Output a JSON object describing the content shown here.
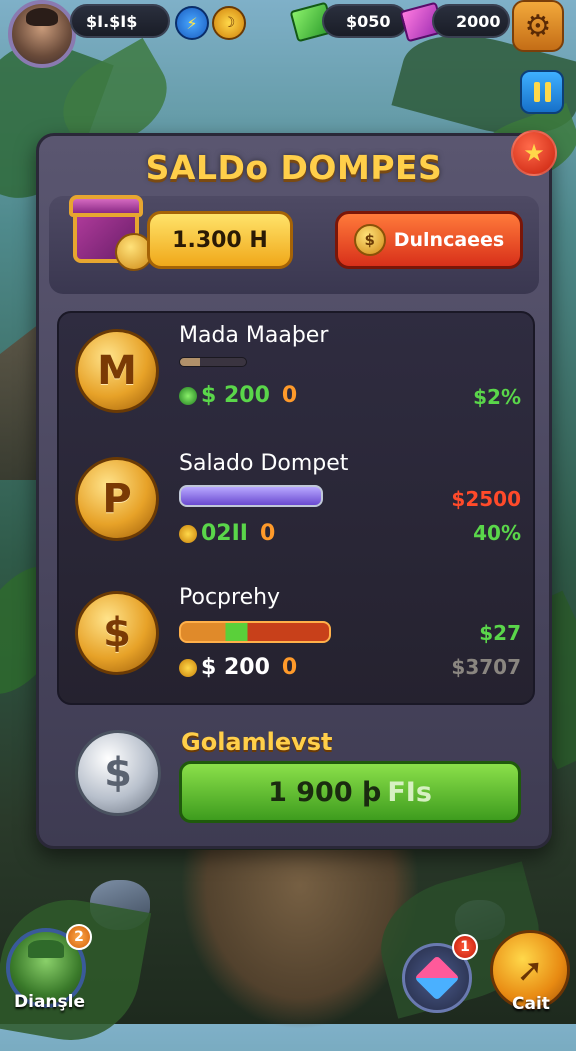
{
  "hud": {
    "currency_1": "$I.$I$",
    "icon_1": "lightning-icon",
    "icon_2": "coin-icon",
    "currency_2": "$050",
    "currency_3": "2000"
  },
  "panel": {
    "title": "SALDo DOMPES",
    "balance": "1.300 H",
    "action_button": "Dulncaees",
    "action_coin_symbol": "$"
  },
  "rows": [
    {
      "name": "Mada Maaþer",
      "coin_symbol": "M",
      "value": "$ 200",
      "value_suffix": "0",
      "right_1": "",
      "right_2": "$2%",
      "right_1_color": "#ff4a2a",
      "right_2_color": "#5ad64a"
    },
    {
      "name": "Salado Dompet",
      "coin_symbol": "P",
      "value": "02II",
      "value_suffix": "0",
      "right_1": "$2500",
      "right_2": "40%",
      "right_1_color": "#ff4a2a",
      "right_2_color": "#5ad64a"
    },
    {
      "name": "Pocprehy",
      "coin_symbol": "$",
      "value": "$ 200",
      "value_suffix": "0",
      "right_1": "$27",
      "right_2": "$3707",
      "right_1_color": "#5ad64a",
      "right_2_color": "#8a8680"
    }
  ],
  "footer": {
    "label": "Golamlevst",
    "coin_symbol": "$",
    "button_value": "1 900 þ",
    "button_suffix": "FIs"
  },
  "bottom": {
    "left_label": "Dianşle",
    "left_badge": "2",
    "box_badge": "1",
    "right_label": "Cait"
  }
}
